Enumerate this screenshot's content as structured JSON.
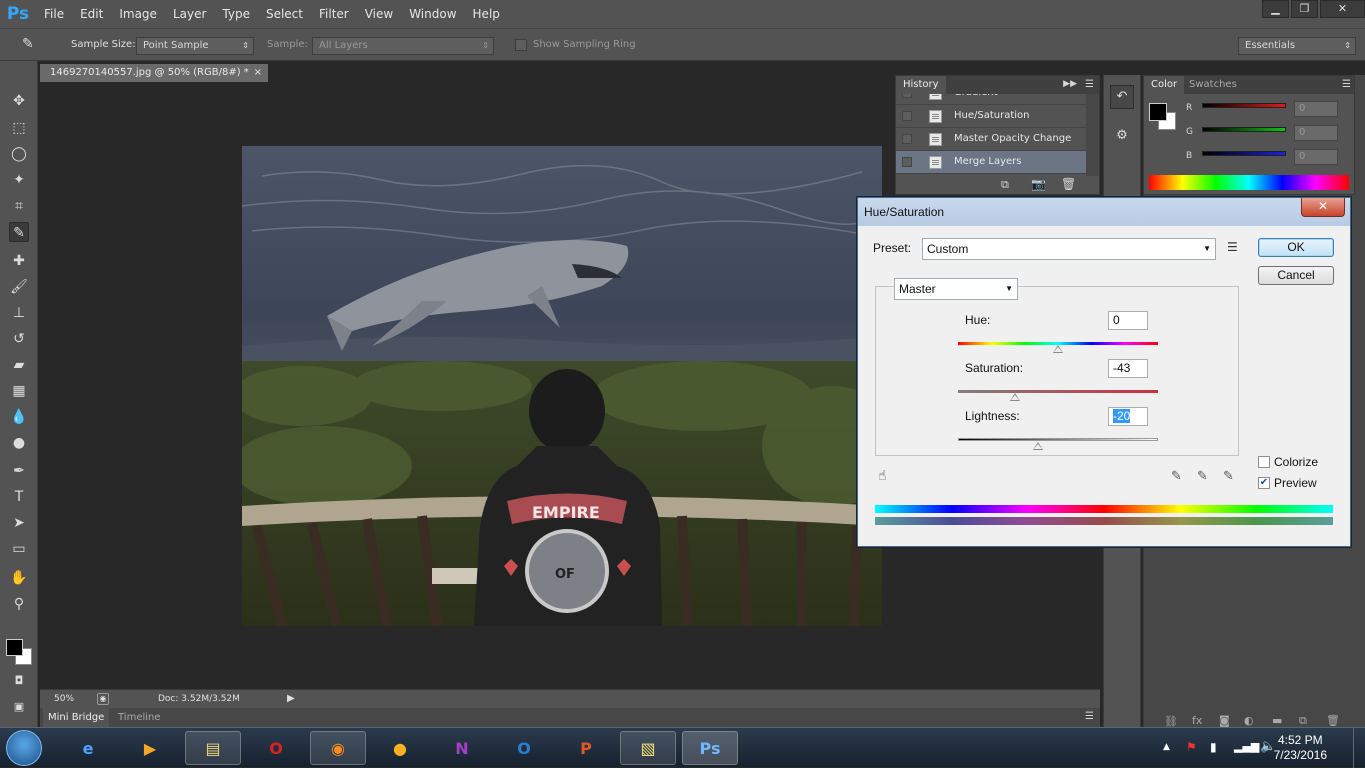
{
  "app": {
    "logo": "Ps"
  },
  "menu": [
    "File",
    "Edit",
    "Image",
    "Layer",
    "Type",
    "Select",
    "Filter",
    "View",
    "Window",
    "Help"
  ],
  "window_controls": {
    "minimize": "▁",
    "restore": "❐",
    "close": "✕"
  },
  "options_bar": {
    "sample_size_label": "Sample Size:",
    "sample_size_value": "Point Sample",
    "sample_label": "Sample:",
    "sample_value": "All Layers",
    "sampling_ring_label": "Show Sampling Ring",
    "workspace": "Essentials"
  },
  "document": {
    "tab_title": "1469270140557.jpg @ 50% (RGB/8#) *",
    "close": "×",
    "photo_shirt_text": "EMPIRE",
    "photo_shirt_center": "OF"
  },
  "status_bar": {
    "zoom": "50%",
    "doc_info": "Doc: 3.52M/3.52M"
  },
  "bottom_tabs": [
    "Mini Bridge",
    "Timeline"
  ],
  "history_panel": {
    "tab": "History",
    "items": [
      {
        "label": "Gradient"
      },
      {
        "label": "Hue/Saturation"
      },
      {
        "label": "Master Opacity Change"
      },
      {
        "label": "Merge Layers",
        "selected": true
      }
    ]
  },
  "color_panel": {
    "tabs": [
      "Color",
      "Swatches"
    ],
    "channels": [
      {
        "label": "R",
        "value": "0",
        "color": "#e31b1b"
      },
      {
        "label": "G",
        "value": "0",
        "color": "#12c412"
      },
      {
        "label": "B",
        "value": "0",
        "color": "#1d1de3"
      }
    ]
  },
  "dialog": {
    "title": "Hue/Saturation",
    "close": "✕",
    "preset_label": "Preset:",
    "preset_value": "Custom",
    "ok": "OK",
    "cancel": "Cancel",
    "channel": "Master",
    "hue_label": "Hue:",
    "hue_value": "0",
    "hue_level": 0.5,
    "saturation_label": "Saturation:",
    "saturation_value": "-43",
    "saturation_level": 0.285,
    "lightness_label": "Lightness:",
    "lightness_value": "-20",
    "lightness_level": 0.4,
    "colorize_label": "Colorize",
    "colorize_checked": false,
    "preview_label": "Preview",
    "preview_checked": true
  },
  "taskbar": {
    "time": "4:52 PM",
    "date": "7/23/2016"
  }
}
